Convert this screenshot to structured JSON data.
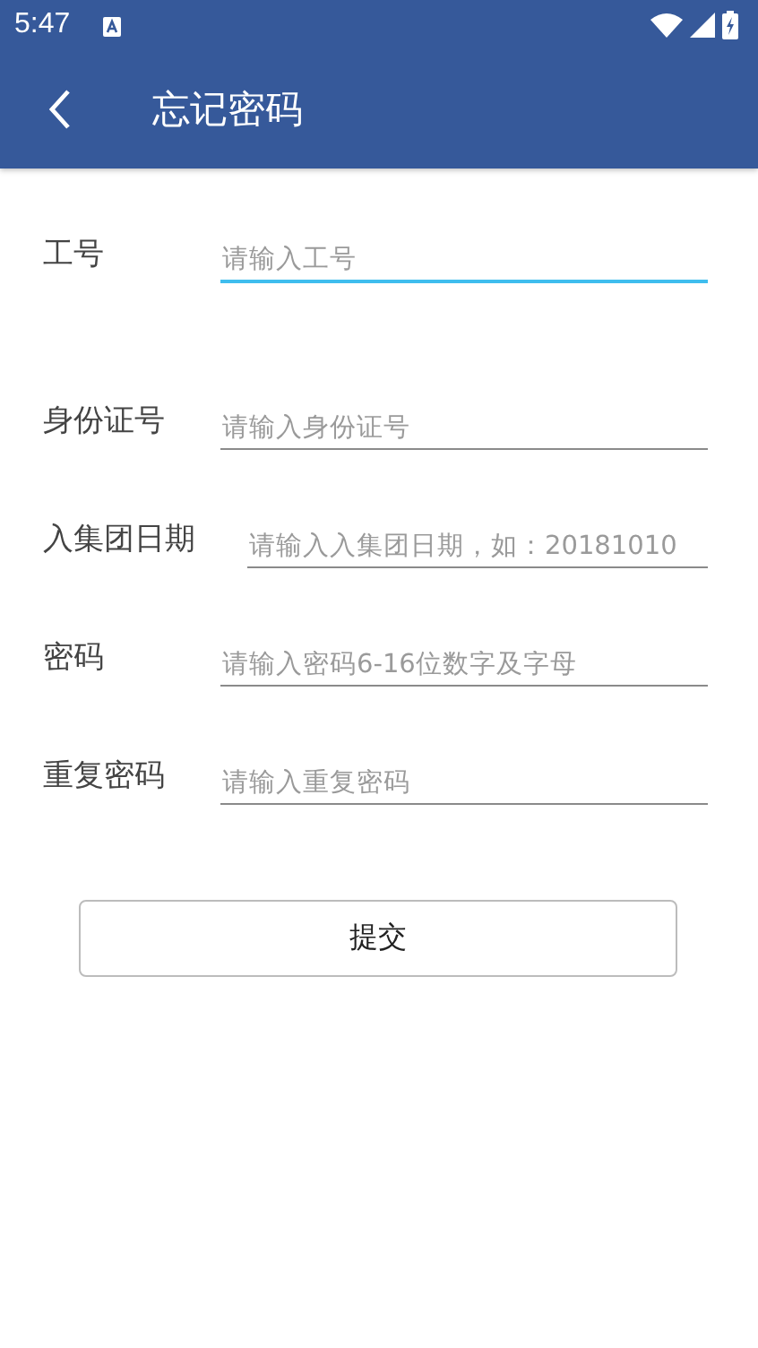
{
  "status_bar": {
    "time": "5:47"
  },
  "app_bar": {
    "title": "忘记密码"
  },
  "fields": [
    {
      "label": "工号",
      "placeholder": "请输入工号",
      "focused": true
    },
    {
      "label": "身份证号",
      "placeholder": "请输入身份证号",
      "focused": false
    },
    {
      "label": "入集团日期",
      "placeholder": "请输入入集团日期，如：20181010",
      "focused": false
    },
    {
      "label": "密码",
      "placeholder": "请输入密码6-16位数字及字母",
      "focused": false
    },
    {
      "label": "重复密码",
      "placeholder": "请输入重复密码",
      "focused": false
    }
  ],
  "submit_button": "提交"
}
